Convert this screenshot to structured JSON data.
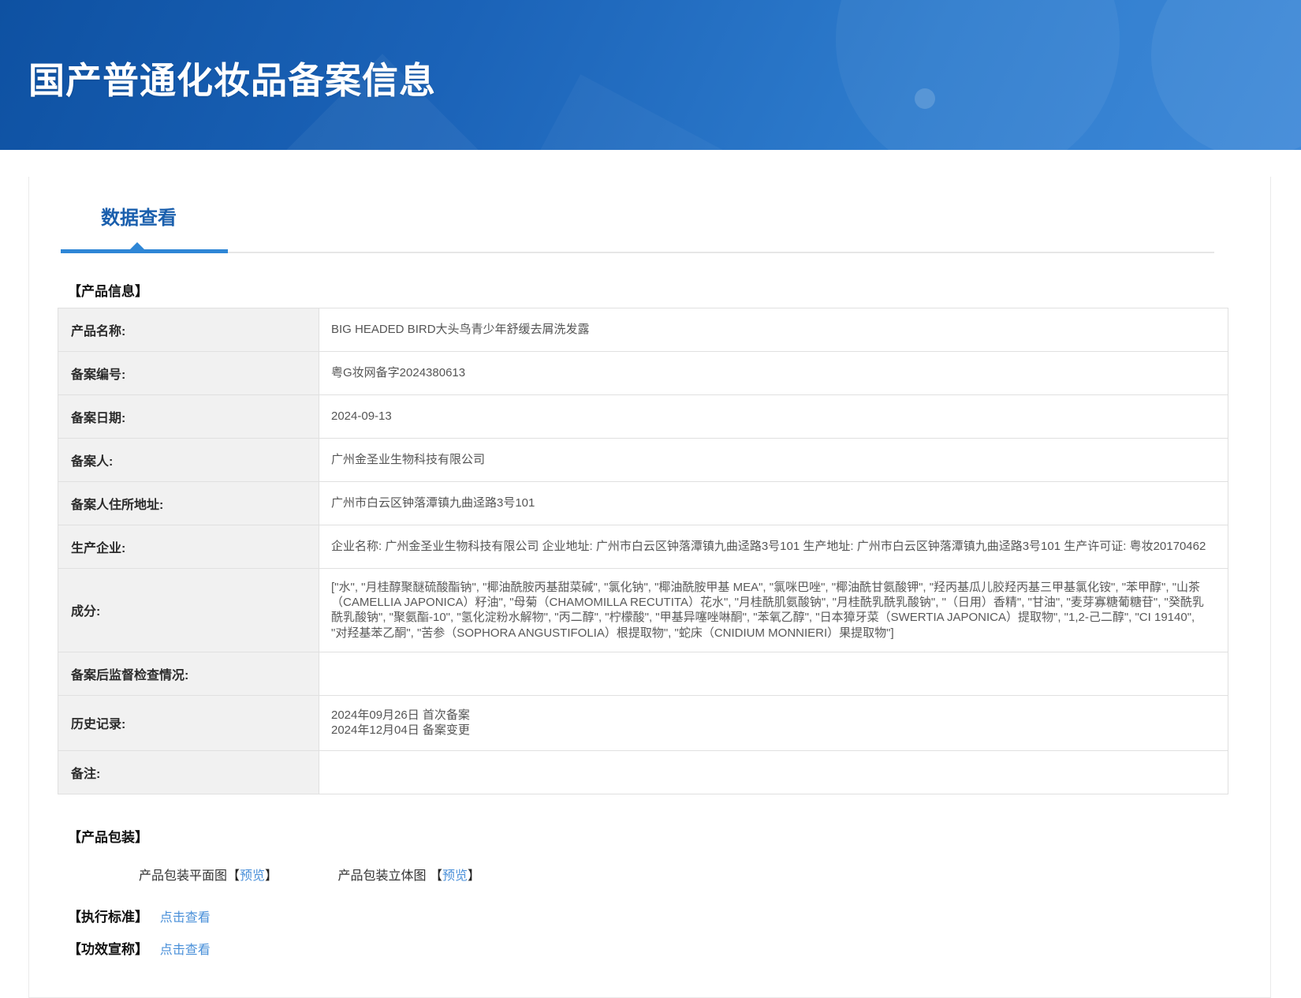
{
  "banner": {
    "title": "国产普通化妆品备案信息"
  },
  "tabs": {
    "data_view": "数据查看"
  },
  "colors": {
    "banner_blue_dark": "#0e51a2",
    "banner_blue_light": "#3f89d8",
    "tab_blue": "#1a5fad",
    "accent_bar_blue": "#2e86d6",
    "link_blue": "#4a90d9",
    "label_cell_bg": "#f1f1f1"
  },
  "sections": {
    "product_info_heading": "【产品信息】",
    "packaging_heading": "【产品包装】",
    "execution_standard_label": "【执行标准】",
    "efficacy_claim_label": "【功效宣称】"
  },
  "table": {
    "product_name": {
      "label": "产品名称:",
      "value": "BIG HEADED BIRD大头鸟青少年舒缓去屑洗发露"
    },
    "filing_number": {
      "label": "备案编号:",
      "value": "粤G妆网备字2024380613"
    },
    "filing_date": {
      "label": "备案日期:",
      "value": "2024-09-13"
    },
    "filer": {
      "label": "备案人:",
      "value": "广州金圣业生物科技有限公司"
    },
    "filer_address": {
      "label": "备案人住所地址:",
      "value": "广州市白云区钟落潭镇九曲迳路3号101"
    },
    "manufacturer": {
      "label": "生产企业:",
      "value": "企业名称: 广州金圣业生物科技有限公司 企业地址: 广州市白云区钟落潭镇九曲迳路3号101 生产地址: 广州市白云区钟落潭镇九曲迳路3号101 生产许可证: 粤妆20170462"
    },
    "ingredients": {
      "label": "成分:",
      "value": "[\"水\", \"月桂醇聚醚硫酸酯钠\", \"椰油酰胺丙基甜菜碱\", \"氯化钠\", \"椰油酰胺甲基 MEA\", \"氯咪巴唑\", \"椰油酰甘氨酸钾\", \"羟丙基瓜儿胶羟丙基三甲基氯化铵\", \"苯甲醇\", \"山茶（CAMELLIA JAPONICA）籽油\", \"母菊（CHAMOMILLA RECUTITA）花水\", \"月桂酰肌氨酸钠\", \"月桂酰乳酰乳酸钠\", \"（日用）香精\", \"甘油\", \"麦芽寡糖葡糖苷\", \"癸酰乳酰乳酸钠\", \"聚氨酯-10\", \"氢化淀粉水解物\", \"丙二醇\", \"柠檬酸\", \"甲基异噻唑啉酮\", \"苯氧乙醇\", \"日本獐牙菜（SWERTIA JAPONICA）提取物\", \"1,2-己二醇\", \"CI 19140\", \"对羟基苯乙酮\", \"苦参（SOPHORA ANGUSTIFOLIA）根提取物\", \"蛇床（CNIDIUM MONNIERI）果提取物\"]"
    },
    "post_filing_inspection": {
      "label": "备案后监督检查情况:",
      "value": ""
    },
    "history": {
      "label": "历史记录:",
      "lines": [
        "2024年09月26日 首次备案",
        "2024年12月04日 备案变更"
      ]
    },
    "remarks": {
      "label": "备注:",
      "value": ""
    }
  },
  "packaging": {
    "flat_label": "产品包装平面图",
    "stereo_label": "产品包装立体图",
    "bracket_open": "【",
    "preview_link": "预览",
    "bracket_close": "】"
  },
  "links": {
    "execution_standard": "点击查看",
    "efficacy_claim": "点击查看"
  }
}
